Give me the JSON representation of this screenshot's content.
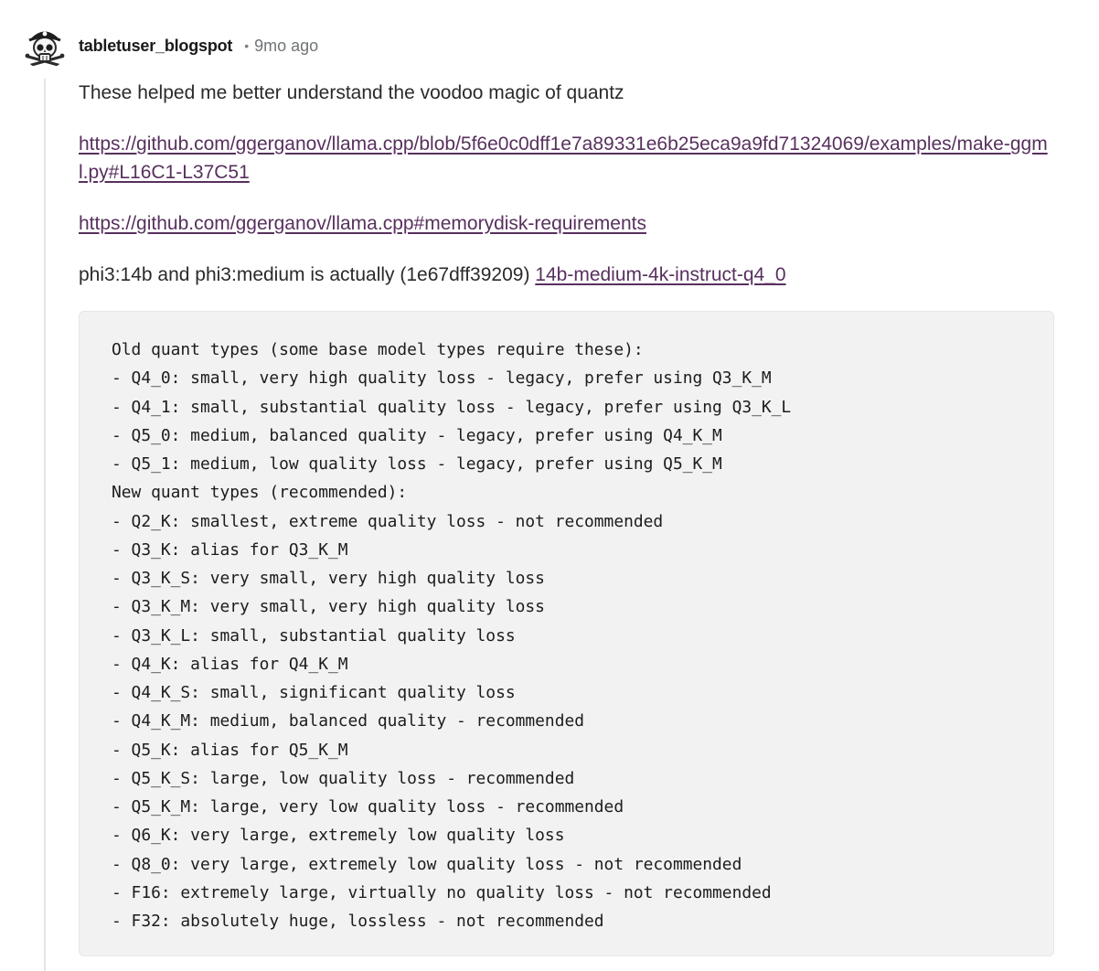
{
  "comment": {
    "username": "tabletuser_blogspot",
    "separator": "•",
    "time": "9mo ago",
    "avatar_icon": "pirate-skull-avatar-icon",
    "paragraph1": "These helped me better understand the voodoo magic of quantz",
    "link1": "https://github.com/ggerganov/llama.cpp/blob/5f6e0c0dff1e7a89331e6b25eca9a9fd71324069/examples/make-ggml.py#L16C1-L37C51",
    "link2": "https://github.com/ggerganov/llama.cpp#memorydisk-requirements",
    "paragraph4_text": "phi3:14b and phi3:medium is actually (1e67dff39209) ",
    "paragraph4_link": "14b-medium-4k-instruct-q4_0",
    "link_color": "#58305e",
    "code_lines": [
      "Old quant types (some base model types require these):",
      "- Q4_0: small, very high quality loss - legacy, prefer using Q3_K_M",
      "- Q4_1: small, substantial quality loss - legacy, prefer using Q3_K_L",
      "- Q5_0: medium, balanced quality - legacy, prefer using Q4_K_M",
      "- Q5_1: medium, low quality loss - legacy, prefer using Q5_K_M",
      "New quant types (recommended):",
      "- Q2_K: smallest, extreme quality loss - not recommended",
      "- Q3_K: alias for Q3_K_M",
      "- Q3_K_S: very small, very high quality loss",
      "- Q3_K_M: very small, very high quality loss",
      "- Q3_K_L: small, substantial quality loss",
      "- Q4_K: alias for Q4_K_M",
      "- Q4_K_S: small, significant quality loss",
      "- Q4_K_M: medium, balanced quality - recommended",
      "- Q5_K: alias for Q5_K_M",
      "- Q5_K_S: large, low quality loss - recommended",
      "- Q5_K_M: large, very low quality loss - recommended",
      "- Q6_K: very large, extremely low quality loss",
      "- Q8_0: very large, extremely low quality loss - not recommended",
      "- F16: extremely large, virtually no quality loss - not recommended",
      "- F32: absolutely huge, lossless - not recommended"
    ]
  }
}
